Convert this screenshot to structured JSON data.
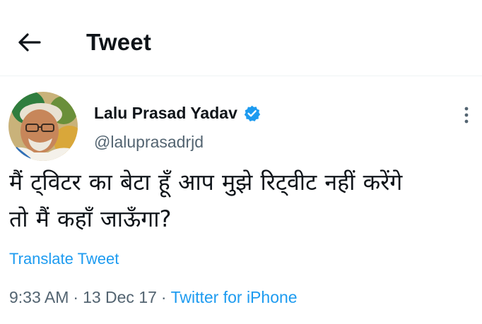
{
  "header": {
    "title": "Tweet",
    "back_icon": "arrow-left-icon"
  },
  "tweet": {
    "author": {
      "name": "Lalu Prasad Yadav",
      "handle": "@laluprasadrjd",
      "verified_icon": "verified-badge-icon"
    },
    "text_line1": "मैं ट्विटर का बेटा हूँ आप मुझे रिट्वीट नहीं करेंगे",
    "text_line2": "तो मैं कहाँ जाऊँगा?",
    "translate_label": "Translate Tweet",
    "time": "9:33 AM",
    "separator": "·",
    "date": "13 Dec 17",
    "source": "Twitter for iPhone",
    "more_icon": "more-vertical-icon"
  },
  "colors": {
    "text": "#0f1419",
    "secondary": "#536471",
    "accent": "#1d9bf0",
    "divider": "#eff3f4"
  }
}
